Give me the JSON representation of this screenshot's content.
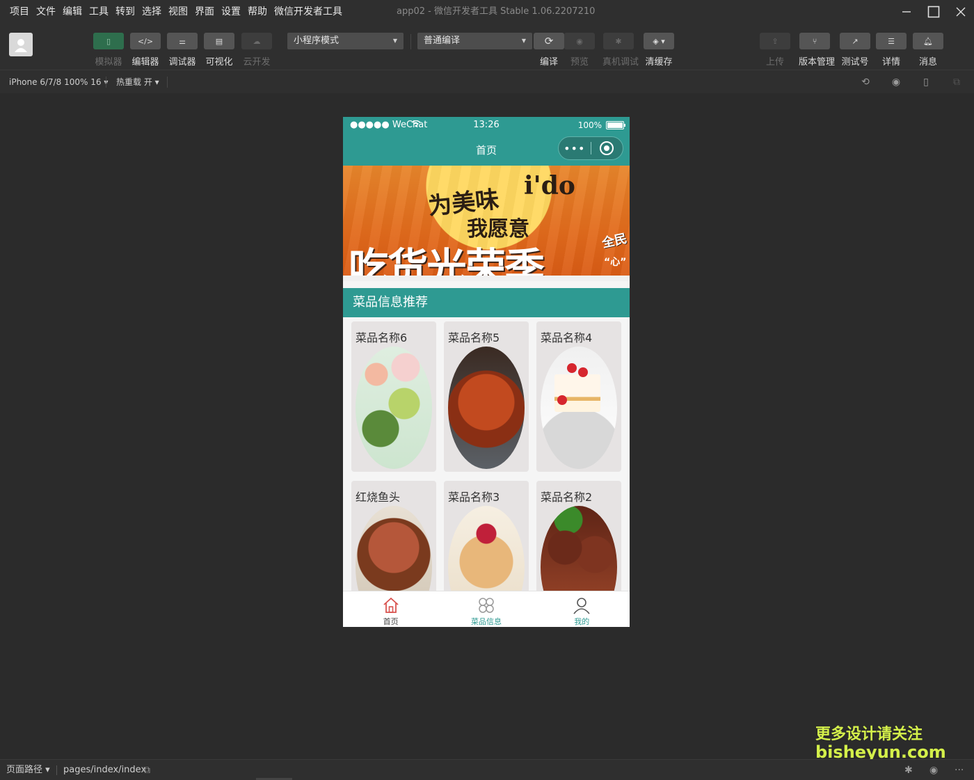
{
  "menu": [
    "项目",
    "文件",
    "编辑",
    "工具",
    "转到",
    "选择",
    "视图",
    "界面",
    "设置",
    "帮助",
    "微信开发者工具"
  ],
  "window_title": "app02 - 微信开发者工具 Stable 1.06.2207210",
  "window_buttons": {
    "minimize": "—",
    "maximize": "☐",
    "close": "✕"
  },
  "toolbar": {
    "simulator": "模拟器",
    "editor": "编辑器",
    "debugger": "调试器",
    "visual": "可视化",
    "cloud": "云开发",
    "mode_select": "小程序模式",
    "compile_select": "普通编译",
    "compile": "编译",
    "preview": "预览",
    "real_debug": "真机调试",
    "clear_cache": "清缓存",
    "upload": "上传",
    "version": "版本管理",
    "test_account": "测试号",
    "details": "详情",
    "messages": "消息"
  },
  "subbar": {
    "device": "iPhone 6/7/8 100% 16 ▾",
    "hot_reload": "热重载 开 ▾"
  },
  "phone": {
    "status": {
      "left": "●●●●● WeChat",
      "time": "13:26",
      "battery": "100%"
    },
    "nav_title": "首页",
    "capsule_dots": "•••",
    "banner": {
      "line1": "为美味",
      "line1b": "i'do",
      "line2": "我愿意",
      "line3": "吃货光荣季",
      "badge": "全民",
      "badge2": "“心”"
    },
    "section_title": "菜品信息推荐",
    "cards": [
      {
        "name": "菜品名称6",
        "image": "salad-plate"
      },
      {
        "name": "菜品名称5",
        "image": "crab-pot"
      },
      {
        "name": "菜品名称4",
        "image": "strawberry-cake"
      },
      {
        "name": "红烧鱼头",
        "image": "braised-fish-head"
      },
      {
        "name": "菜品名称3",
        "image": "pancakes"
      },
      {
        "name": "菜品名称2",
        "image": "grilled-skewers"
      }
    ],
    "tabs": [
      {
        "label": "首页",
        "icon": "home-icon",
        "color": "#555555"
      },
      {
        "label": "菜品信息",
        "icon": "grid-icon",
        "color": "#2e9a92"
      },
      {
        "label": "我的",
        "icon": "user-icon",
        "color": "#2e9a92"
      }
    ]
  },
  "watermark": {
    "line1": "更多设计请关注",
    "line2": "bisheyun.com"
  },
  "bottombar": {
    "page_path_label": "页面路径 ▾",
    "page_path": "pages/index/index"
  },
  "colors": {
    "accent": "#2e9a92",
    "bg": "#2b2b2b",
    "toolbar": "#2f2f2f"
  }
}
